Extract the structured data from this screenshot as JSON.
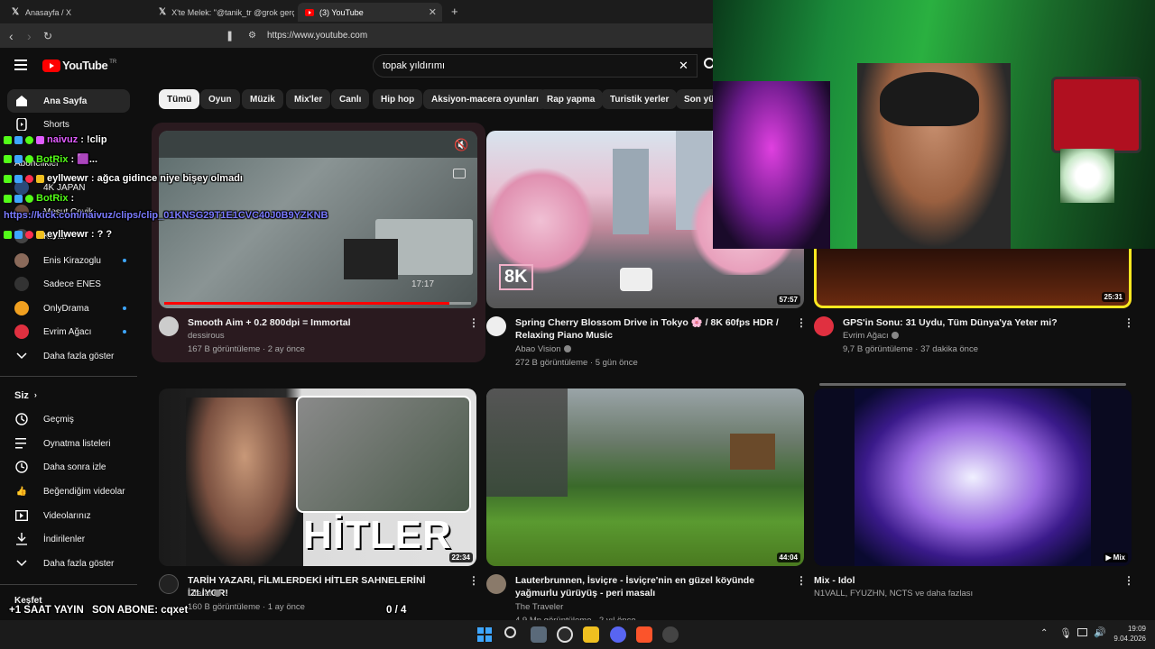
{
  "browser": {
    "tabs": [
      {
        "label": "Anasayfa / X",
        "icon": "x-logo-icon"
      },
      {
        "label": "X'te Melek: \"@tanik_tr @grok gerçek",
        "icon": "x-logo-icon"
      },
      {
        "label": "(3) YouTube",
        "icon": "youtube-icon"
      }
    ],
    "url": "https://www.youtube.com",
    "new_tab": "+"
  },
  "youtube": {
    "logo_text": "YouTube",
    "logo_region": "TR",
    "search_value": "topak yıldırımı",
    "chips": [
      "Tümü",
      "Oyun",
      "Müzik",
      "Mix'ler",
      "Canlı",
      "Hip hop",
      "Aksiyon-macera oyunları",
      "Rap yapma",
      "Turistik yerler",
      "Son yük"
    ]
  },
  "sidebar": {
    "home": "Ana Sayfa",
    "shorts": "Shorts",
    "subscriptions_header": "Abonelikler",
    "subs": [
      {
        "label": "4K JAPAN"
      },
      {
        "label": "Mesut Cevik"
      },
      {
        "label": "Kanal"
      },
      {
        "label": "Enis Kirazoglu"
      },
      {
        "label": "Sadece ENES"
      },
      {
        "label": "OnlyDrama"
      },
      {
        "label": "Evrim Ağacı"
      }
    ],
    "show_more": "Daha fazla göster",
    "you_header": "Siz",
    "you_items": [
      "Geçmiş",
      "Oynatma listeleri",
      "Daha sonra izle",
      "Beğendiğim videolar",
      "Videolarınız",
      "İndirilenler"
    ],
    "show_more_2": "Daha fazla göster",
    "explore": "Keşfet"
  },
  "videos": [
    {
      "title": "Smooth Aim + 0.2 800dpi = Immortal",
      "channel": "dessirous",
      "meta": "167 B görüntüleme · 2 ay önce",
      "hover_time": "17:17",
      "progress": 0.93
    },
    {
      "title": "Spring Cherry Blossom Drive in Tokyo 🌸 / 8K 60fps HDR / Relaxing Piano Music",
      "channel": "Abao Vision",
      "meta": "272 B görüntüleme · 5 gün önce",
      "duration": "57:57",
      "badge": "8K"
    },
    {
      "title": "GPS'in Sonu: 31 Uydu, Tüm Dünya'ya Yeter mi?",
      "channel": "Evrim Ağacı",
      "meta": "9,7 B görüntüleme · 37 dakika önce",
      "duration": "25:31"
    },
    {
      "title": "TARİH YAZARI, FİLMLERDEKİ HİTLER SAHNELERİNİ İZLİYOR!",
      "channel": "Literat",
      "meta": "160 B görüntüleme · 1 ay önce",
      "duration": "22:34",
      "thumb_text": "HİTLER"
    },
    {
      "title": "Lauterbrunnen, İsviçre - İsviçre'nin en güzel köyünde yağmurlu yürüyüş - peri masalı",
      "channel": "The Traveler",
      "meta": "4,9 Mn görüntüleme · 2 yıl önce",
      "duration": "44:04"
    },
    {
      "title": "Mix - Idol",
      "channel": "",
      "meta": "N1VALL, FYUZHN, NCTS ve daha fazlası",
      "duration": "Mix"
    }
  ],
  "chat": [
    {
      "user": "naivuz",
      "message": ": !clip",
      "color": "#e05cff"
    },
    {
      "user": "BotRix",
      "message": ": 🟪...",
      "color": "#53fc18"
    },
    {
      "user": "eyllwewr",
      "message": ": ağca gidince niye bişey olmadı",
      "color": "#ffffff"
    },
    {
      "user": "BotRix",
      "message": ":",
      "color": "#53fc18"
    },
    {
      "user": "",
      "message": "https://kick.com/naivuz/clips/clip_01KNSG29T1E1CVC40J0B9YZKNB",
      "color": "#7a7aff"
    },
    {
      "user": "eyllwewr",
      "message": ": ? ?",
      "color": "#ffffff"
    }
  ],
  "overlay": {
    "timer_label": "+1 SAAT YAYIN",
    "last_sub_label": "SON ABONE: cqxet",
    "goal_count": "0 / 4"
  },
  "taskbar": {
    "time": "19:09",
    "date": "9.04.2026"
  },
  "colors": {
    "yt_red": "#ff0000",
    "chat_green": "#53fc18",
    "link_blue": "#3ea6ff"
  }
}
